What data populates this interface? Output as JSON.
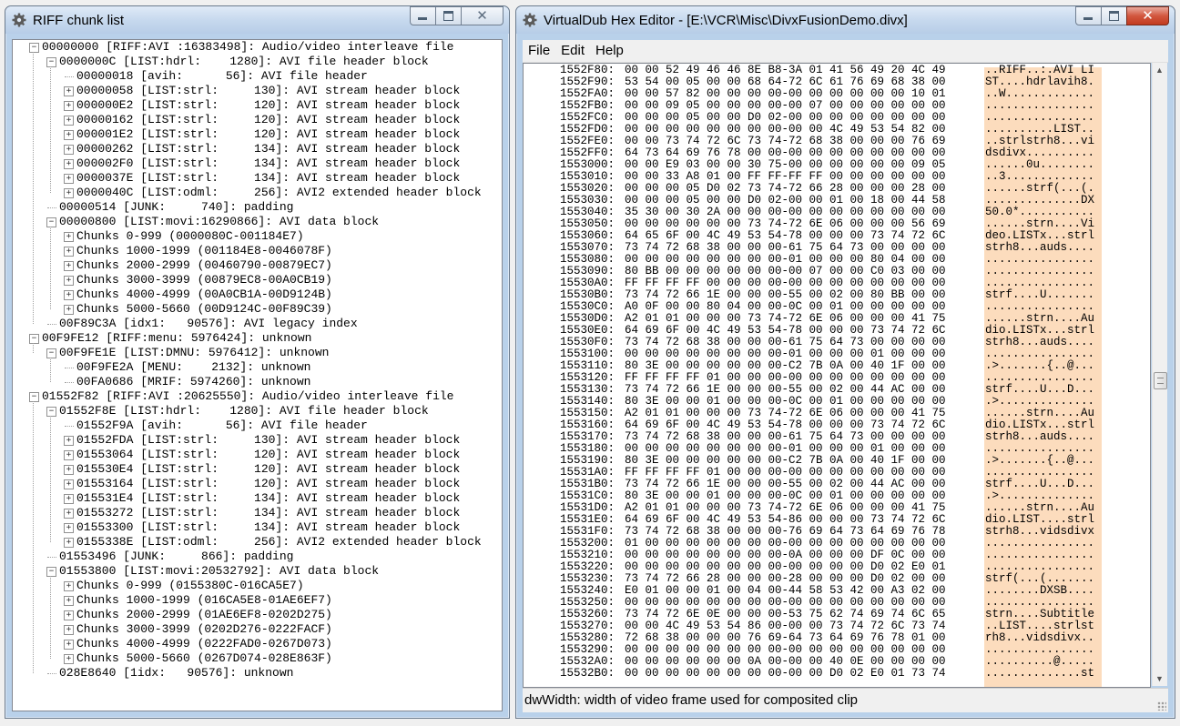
{
  "riff_window": {
    "title": "RIFF chunk list",
    "icon": "gear-icon",
    "tree": [
      {
        "depth": 0,
        "expander": "minus",
        "text": "00000000 [RIFF:AVI :16383498]: Audio/video interleave file"
      },
      {
        "depth": 1,
        "expander": "minus",
        "text": "0000000C [LIST:hdrl:    1280]: AVI file header block"
      },
      {
        "depth": 2,
        "expander": "none",
        "text": "00000018 [avih:      56]: AVI file header"
      },
      {
        "depth": 2,
        "expander": "plus",
        "text": "00000058 [LIST:strl:     130]: AVI stream header block"
      },
      {
        "depth": 2,
        "expander": "plus",
        "text": "000000E2 [LIST:strl:     120]: AVI stream header block"
      },
      {
        "depth": 2,
        "expander": "plus",
        "text": "00000162 [LIST:strl:     120]: AVI stream header block"
      },
      {
        "depth": 2,
        "expander": "plus",
        "text": "000001E2 [LIST:strl:     120]: AVI stream header block"
      },
      {
        "depth": 2,
        "expander": "plus",
        "text": "00000262 [LIST:strl:     134]: AVI stream header block"
      },
      {
        "depth": 2,
        "expander": "plus",
        "text": "000002F0 [LIST:strl:     134]: AVI stream header block"
      },
      {
        "depth": 2,
        "expander": "plus",
        "text": "0000037E [LIST:strl:     134]: AVI stream header block"
      },
      {
        "depth": 2,
        "expander": "plus",
        "text": "0000040C [LIST:odml:     256]: AVI2 extended header block"
      },
      {
        "depth": 1,
        "expander": "none",
        "text": "00000514 [JUNK:     740]: padding"
      },
      {
        "depth": 1,
        "expander": "minus",
        "text": "00000800 [LIST:movi:16290866]: AVI data block"
      },
      {
        "depth": 2,
        "expander": "plus",
        "text": "Chunks 0-999 (0000080C-001184E7)"
      },
      {
        "depth": 2,
        "expander": "plus",
        "text": "Chunks 1000-1999 (001184E8-0046078F)"
      },
      {
        "depth": 2,
        "expander": "plus",
        "text": "Chunks 2000-2999 (00460790-00879EC7)"
      },
      {
        "depth": 2,
        "expander": "plus",
        "text": "Chunks 3000-3999 (00879EC8-00A0CB19)"
      },
      {
        "depth": 2,
        "expander": "plus",
        "text": "Chunks 4000-4999 (00A0CB1A-00D9124B)"
      },
      {
        "depth": 2,
        "expander": "plus",
        "text": "Chunks 5000-5660 (00D9124C-00F89C39)"
      },
      {
        "depth": 1,
        "expander": "none",
        "text": "00F89C3A [idx1:   90576]: AVI legacy index"
      },
      {
        "depth": 0,
        "expander": "minus",
        "text": "00F9FE12 [RIFF:menu: 5976424]: unknown"
      },
      {
        "depth": 1,
        "expander": "minus",
        "text": "00F9FE1E [LIST:DMNU: 5976412]: unknown"
      },
      {
        "depth": 2,
        "expander": "none",
        "text": "00F9FE2A [MENU:    2132]: unknown"
      },
      {
        "depth": 2,
        "expander": "none",
        "text": "00FA0686 [MRIF: 5974260]: unknown"
      },
      {
        "depth": 0,
        "expander": "minus",
        "text": "01552F82 [RIFF:AVI :20625550]: Audio/video interleave file"
      },
      {
        "depth": 1,
        "expander": "minus",
        "text": "01552F8E [LIST:hdrl:    1280]: AVI file header block"
      },
      {
        "depth": 2,
        "expander": "none",
        "text": "01552F9A [avih:      56]: AVI file header"
      },
      {
        "depth": 2,
        "expander": "plus",
        "text": "01552FDA [LIST:strl:     130]: AVI stream header block"
      },
      {
        "depth": 2,
        "expander": "plus",
        "text": "01553064 [LIST:strl:     120]: AVI stream header block"
      },
      {
        "depth": 2,
        "expander": "plus",
        "text": "015530E4 [LIST:strl:     120]: AVI stream header block"
      },
      {
        "depth": 2,
        "expander": "plus",
        "text": "01553164 [LIST:strl:     120]: AVI stream header block"
      },
      {
        "depth": 2,
        "expander": "plus",
        "text": "015531E4 [LIST:strl:     134]: AVI stream header block"
      },
      {
        "depth": 2,
        "expander": "plus",
        "text": "01553272 [LIST:strl:     134]: AVI stream header block"
      },
      {
        "depth": 2,
        "expander": "plus",
        "text": "01553300 [LIST:strl:     134]: AVI stream header block"
      },
      {
        "depth": 2,
        "expander": "plus",
        "text": "0155338E [LIST:odml:     256]: AVI2 extended header block"
      },
      {
        "depth": 1,
        "expander": "none",
        "text": "01553496 [JUNK:     866]: padding"
      },
      {
        "depth": 1,
        "expander": "minus",
        "text": "01553800 [LIST:movi:20532792]: AVI data block"
      },
      {
        "depth": 2,
        "expander": "plus",
        "text": "Chunks 0-999 (0155380C-016CA5E7)"
      },
      {
        "depth": 2,
        "expander": "plus",
        "text": "Chunks 1000-1999 (016CA5E8-01AE6EF7)"
      },
      {
        "depth": 2,
        "expander": "plus",
        "text": "Chunks 2000-2999 (01AE6EF8-0202D275)"
      },
      {
        "depth": 2,
        "expander": "plus",
        "text": "Chunks 3000-3999 (0202D276-0222FACF)"
      },
      {
        "depth": 2,
        "expander": "plus",
        "text": "Chunks 4000-4999 (0222FAD0-0267D073)"
      },
      {
        "depth": 2,
        "expander": "plus",
        "text": "Chunks 5000-5660 (0267D074-028E863F)"
      },
      {
        "depth": 1,
        "expander": "none",
        "text": "028E8640 [1idx:   90576]: unknown"
      }
    ]
  },
  "hex_window": {
    "title": "VirtualDub Hex Editor - [E:\\VCR\\Misc\\DivxFusionDemo.divx]",
    "icon": "gear-icon",
    "menu": [
      "File",
      "Edit",
      "Help"
    ],
    "status": "dwWidth: width of video frame used for composited clip",
    "colors": {
      "ascii_highlight": "#fcdcbd"
    },
    "rows": [
      [
        "1552F80:",
        "00 00 52 49 46 46 8E B8-3A 01 41 56 49 20 4C 49",
        "..RIFF..:.AVI LI"
      ],
      [
        "1552F90:",
        "53 54 00 05 00 00 68 64-72 6C 61 76 69 68 38 00",
        "ST....hdrlavih8."
      ],
      [
        "1552FA0:",
        "00 00 57 82 00 00 00 00-00 00 00 00 00 00 10 01",
        "..W............."
      ],
      [
        "1552FB0:",
        "00 00 09 05 00 00 00 00-00 07 00 00 00 00 00 00",
        "................"
      ],
      [
        "1552FC0:",
        "00 00 00 05 00 00 D0 02-00 00 00 00 00 00 00 00",
        "................"
      ],
      [
        "1552FD0:",
        "00 00 00 00 00 00 00 00-00 00 4C 49 53 54 82 00",
        "..........LIST.."
      ],
      [
        "1552FE0:",
        "00 00 73 74 72 6C 73 74-72 68 38 00 00 00 76 69",
        "..strlstrh8...vi"
      ],
      [
        "1552FF0:",
        "64 73 64 69 76 78 00 00-00 00 00 00 00 00 00 00",
        "dsdivx.........."
      ],
      [
        "1553000:",
        "00 00 E9 03 00 00 30 75-00 00 00 00 00 00 09 05",
        "......0u........"
      ],
      [
        "1553010:",
        "00 00 33 A8 01 00 FF FF-FF FF 00 00 00 00 00 00",
        "..3............."
      ],
      [
        "1553020:",
        "00 00 00 05 D0 02 73 74-72 66 28 00 00 00 28 00",
        "......strf(...(."
      ],
      [
        "1553030:",
        "00 00 00 05 00 00 D0 02-00 00 01 00 18 00 44 58",
        "..............DX"
      ],
      [
        "1553040:",
        "35 30 00 30 2A 00 00 00-00 00 00 00 00 00 00 00",
        "50.0*..........."
      ],
      [
        "1553050:",
        "00 00 00 00 00 00 73 74-72 6E 06 00 00 00 56 69",
        "......strn....Vi"
      ],
      [
        "1553060:",
        "64 65 6F 00 4C 49 53 54-78 00 00 00 73 74 72 6C",
        "deo.LISTx...strl"
      ],
      [
        "1553070:",
        "73 74 72 68 38 00 00 00-61 75 64 73 00 00 00 00",
        "strh8...auds...."
      ],
      [
        "1553080:",
        "00 00 00 00 00 00 00 00-01 00 00 00 80 04 00 00",
        "................"
      ],
      [
        "1553090:",
        "80 BB 00 00 00 00 00 00-00 07 00 00 C0 03 00 00",
        "................"
      ],
      [
        "15530A0:",
        "FF FF FF FF 00 00 00 00-00 00 00 00 00 00 00 00",
        "................"
      ],
      [
        "15530B0:",
        "73 74 72 66 1E 00 00 00-55 00 02 00 80 BB 00 00",
        "strf....U......."
      ],
      [
        "15530C0:",
        "A0 0F 00 00 80 04 00 00-0C 00 01 00 00 00 00 00",
        "................"
      ],
      [
        "15530D0:",
        "A2 01 01 00 00 00 73 74-72 6E 06 00 00 00 41 75",
        "......strn....Au"
      ],
      [
        "15530E0:",
        "64 69 6F 00 4C 49 53 54-78 00 00 00 73 74 72 6C",
        "dio.LISTx...strl"
      ],
      [
        "15530F0:",
        "73 74 72 68 38 00 00 00-61 75 64 73 00 00 00 00",
        "strh8...auds...."
      ],
      [
        "1553100:",
        "00 00 00 00 00 00 00 00-01 00 00 00 01 00 00 00",
        "................"
      ],
      [
        "1553110:",
        "80 3E 00 00 00 00 00 00-C2 7B 0A 00 40 1F 00 00",
        ".>.......{..@..."
      ],
      [
        "1553120:",
        "FF FF FF FF 01 00 00 00-00 00 00 00 00 00 00 00",
        "................"
      ],
      [
        "1553130:",
        "73 74 72 66 1E 00 00 00-55 00 02 00 44 AC 00 00",
        "strf....U...D..."
      ],
      [
        "1553140:",
        "80 3E 00 00 01 00 00 00-0C 00 01 00 00 00 00 00",
        ".>.............."
      ],
      [
        "1553150:",
        "A2 01 01 00 00 00 73 74-72 6E 06 00 00 00 41 75",
        "......strn....Au"
      ],
      [
        "1553160:",
        "64 69 6F 00 4C 49 53 54-78 00 00 00 73 74 72 6C",
        "dio.LISTx...strl"
      ],
      [
        "1553170:",
        "73 74 72 68 38 00 00 00-61 75 64 73 00 00 00 00",
        "strh8...auds...."
      ],
      [
        "1553180:",
        "00 00 00 00 00 00 00 00-01 00 00 00 01 00 00 00",
        "................"
      ],
      [
        "1553190:",
        "80 3E 00 00 00 00 00 00-C2 7B 0A 00 40 1F 00 00",
        ".>.......{..@..."
      ],
      [
        "15531A0:",
        "FF FF FF FF 01 00 00 00-00 00 00 00 00 00 00 00",
        "................"
      ],
      [
        "15531B0:",
        "73 74 72 66 1E 00 00 00-55 00 02 00 44 AC 00 00",
        "strf....U...D..."
      ],
      [
        "15531C0:",
        "80 3E 00 00 01 00 00 00-0C 00 01 00 00 00 00 00",
        ".>.............."
      ],
      [
        "15531D0:",
        "A2 01 01 00 00 00 73 74-72 6E 06 00 00 00 41 75",
        "......strn....Au"
      ],
      [
        "15531E0:",
        "64 69 6F 00 4C 49 53 54-86 00 00 00 73 74 72 6C",
        "dio.LIST....strl"
      ],
      [
        "15531F0:",
        "73 74 72 68 38 00 00 00-76 69 64 73 64 69 76 78",
        "strh8...vidsdivx"
      ],
      [
        "1553200:",
        "01 00 00 00 00 00 00 00-00 00 00 00 00 00 00 00",
        "................"
      ],
      [
        "1553210:",
        "00 00 00 00 00 00 00 00-0A 00 00 00 DF 0C 00 00",
        "................"
      ],
      [
        "1553220:",
        "00 00 00 00 00 00 00 00-00 00 00 00 D0 02 E0 01",
        "................"
      ],
      [
        "1553230:",
        "73 74 72 66 28 00 00 00-28 00 00 00 D0 02 00 00",
        "strf(...(......."
      ],
      [
        "1553240:",
        "E0 01 00 00 01 00 04 00-44 58 53 42 00 A3 02 00",
        "........DXSB...."
      ],
      [
        "1553250:",
        "00 00 00 00 00 00 00 00-00 00 00 00 00 00 00 00",
        "................"
      ],
      [
        "1553260:",
        "73 74 72 6E 0E 00 00 00-53 75 62 74 69 74 6C 65",
        "strn....Subtitle"
      ],
      [
        "1553270:",
        "00 00 4C 49 53 54 86 00-00 00 73 74 72 6C 73 74",
        "..LIST....strlst"
      ],
      [
        "1553280:",
        "72 68 38 00 00 00 76 69-64 73 64 69 76 78 01 00",
        "rh8...vidsdivx.."
      ],
      [
        "1553290:",
        "00 00 00 00 00 00 00 00-00 00 00 00 00 00 00 00",
        "................"
      ],
      [
        "15532A0:",
        "00 00 00 00 00 00 0A 00-00 00 40 0E 00 00 00 00",
        "..........@....."
      ],
      [
        "15532B0:",
        "00 00 00 00 00 00 00 00-00 00 D0 02 E0 01 73 74",
        "..............st"
      ]
    ]
  }
}
